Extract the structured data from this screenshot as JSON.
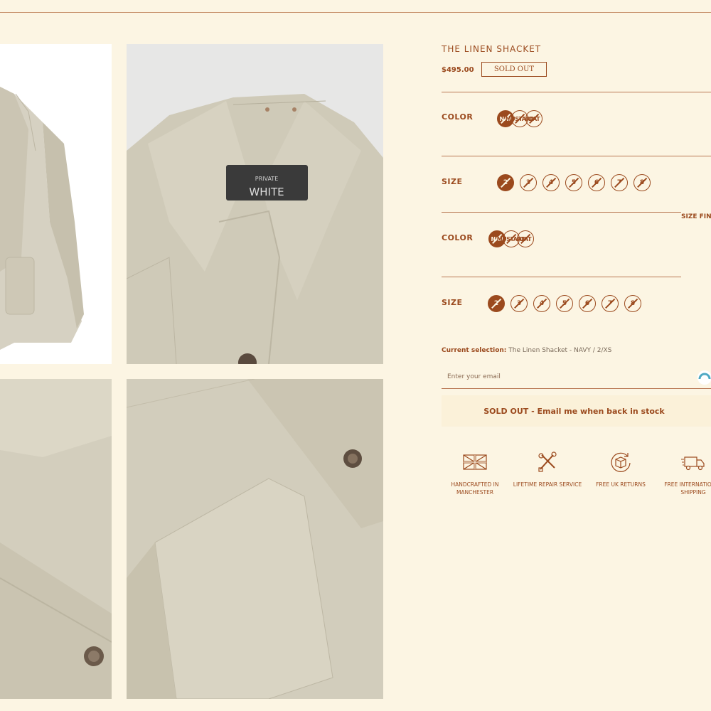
{
  "product": {
    "title": "THE LINEN SHACKET",
    "price": "$495.00",
    "badge": "SOLD OUT"
  },
  "options": [
    {
      "label": "COLOR",
      "swatches": [
        {
          "label": "NAV",
          "selected": true
        },
        {
          "label": "MUSTARD",
          "selected": false
        },
        {
          "label": "OAT",
          "selected": false
        }
      ]
    },
    {
      "label": "SIZE",
      "sizes": [
        {
          "label": "2",
          "selected": true
        },
        {
          "label": "3",
          "selected": false
        },
        {
          "label": "4",
          "selected": false
        },
        {
          "label": "5",
          "selected": false
        },
        {
          "label": "6",
          "selected": false
        },
        {
          "label": "7",
          "selected": false
        },
        {
          "label": "8",
          "selected": false
        }
      ]
    }
  ],
  "size_guide": "SIZE FIN",
  "current_selection": {
    "label": "Current selection:",
    "value": "The Linen Shacket - NAVY / 2/XS"
  },
  "email": {
    "placeholder": "Enter your email"
  },
  "notify_button": "SOLD OUT - Email me when back in stock",
  "features": [
    {
      "icon": "uk-flag-icon",
      "label": "HANDCRAFTED IN MANCHESTER"
    },
    {
      "icon": "repair-tools-icon",
      "label": "LIFETIME REPAIR SERVICE"
    },
    {
      "icon": "returns-box-icon",
      "label": "FREE UK RETURNS"
    },
    {
      "icon": "delivery-truck-icon",
      "label": "FREE INTERNATIONAL SHIPPING"
    }
  ],
  "gallery": {
    "label_brand_small": "PRIVATE",
    "label_brand_large": "WHITE"
  },
  "colors": {
    "accent": "#9b4a1e",
    "background": "#fcf5e3",
    "linen": "#cfc9b6"
  }
}
